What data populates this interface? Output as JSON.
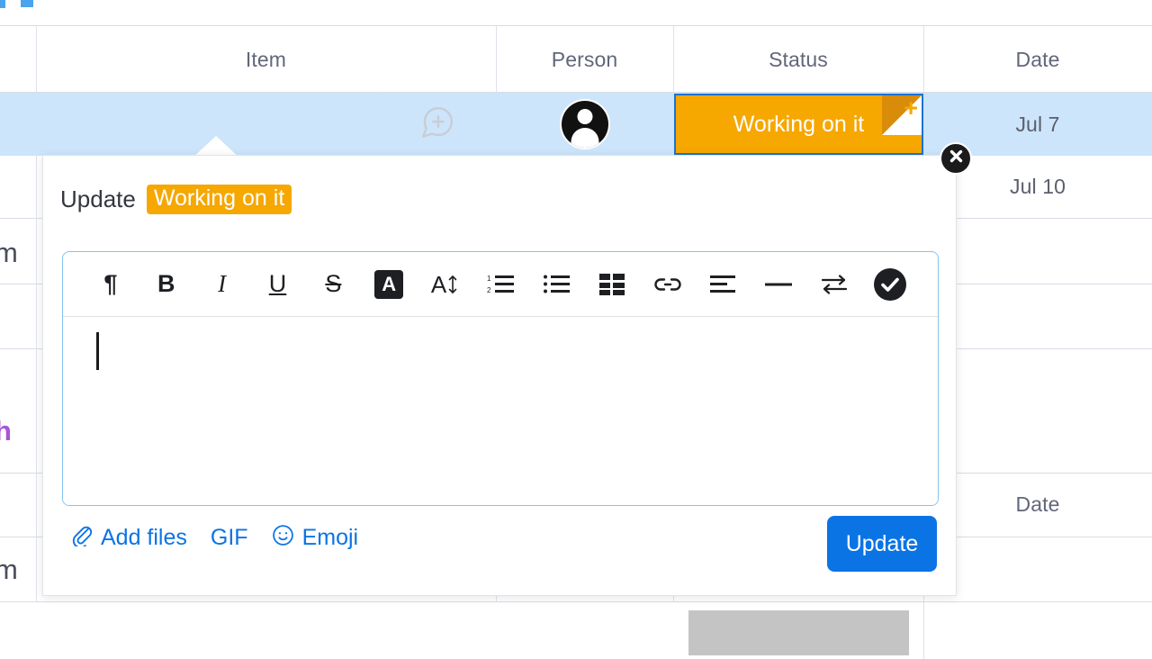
{
  "board": {
    "columns": [
      {
        "key": "item",
        "label": "Item"
      },
      {
        "key": "person",
        "label": "Person"
      },
      {
        "key": "status",
        "label": "Status"
      },
      {
        "key": "date",
        "label": "Date"
      }
    ],
    "second_group_header": "Date",
    "rows": [
      {
        "date": "Jul 7",
        "status": "Working on it",
        "selected": true
      },
      {
        "date": "Jul 10"
      }
    ],
    "edge_fragments": [
      {
        "text": "m",
        "color": "#4a4e5c"
      },
      {
        "text": "h",
        "color": "#a855d6"
      },
      {
        "text": "m",
        "color": "#4a4e5c"
      }
    ],
    "icons": {
      "add_comment": "comment-plus-icon",
      "avatar": "person-avatar-icon",
      "close": "close-x-icon"
    }
  },
  "status_chip": {
    "label": "Working on it",
    "color": "#f6a700",
    "fold_color": "#d98b0a",
    "selection_border": "#1a73d4",
    "plus": "+"
  },
  "panel": {
    "title_word": "Update",
    "title_chip": "Working on it",
    "chip_color": "#f6a700",
    "editor": {
      "value": "",
      "caret_visible": true,
      "border_color": "#86c2ec"
    },
    "toolbar": [
      {
        "name": "paragraph-icon",
        "glyph": "¶",
        "title": "Paragraph"
      },
      {
        "name": "bold-icon",
        "glyph": "B",
        "title": "Bold"
      },
      {
        "name": "italic-icon",
        "glyph": "I",
        "title": "Italic"
      },
      {
        "name": "underline-icon",
        "glyph": "U",
        "title": "Underline"
      },
      {
        "name": "strikethrough-icon",
        "glyph": "S",
        "title": "Strikethrough"
      },
      {
        "name": "text-color-icon",
        "glyph": "A",
        "title": "Text color"
      },
      {
        "name": "font-size-icon",
        "glyph": "A",
        "title": "Font size"
      },
      {
        "name": "numbered-list-icon",
        "glyph": "",
        "title": "Numbered list"
      },
      {
        "name": "bulleted-list-icon",
        "glyph": "",
        "title": "Bulleted list"
      },
      {
        "name": "table-icon",
        "glyph": "",
        "title": "Table"
      },
      {
        "name": "link-icon",
        "glyph": "",
        "title": "Link"
      },
      {
        "name": "align-left-icon",
        "glyph": "",
        "title": "Align"
      },
      {
        "name": "horizontal-rule-icon",
        "glyph": "",
        "title": "Horizontal rule"
      },
      {
        "name": "swap-arrows-icon",
        "glyph": "",
        "title": "Swap"
      },
      {
        "name": "check-circle-icon",
        "glyph": "",
        "title": "Done"
      }
    ],
    "footer": {
      "add_files": "Add files",
      "gif": "GIF",
      "emoji": "Emoji",
      "update_button": "Update",
      "update_button_color": "#0b74e5"
    }
  }
}
